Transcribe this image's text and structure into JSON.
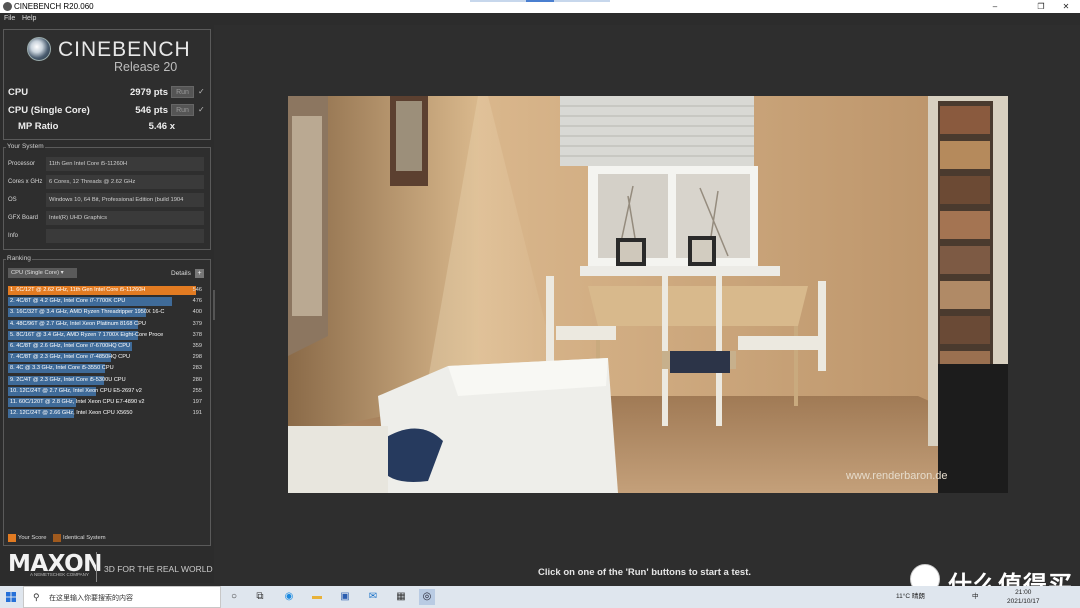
{
  "window": {
    "title": "CINEBENCH R20.060",
    "minimize": "–",
    "maximize": "❐",
    "close": "✕"
  },
  "menu": {
    "file": "File",
    "help": "Help"
  },
  "brand": {
    "name": "CINEBENCH",
    "release": "Release 20"
  },
  "scores": {
    "cpu_label": "CPU",
    "cpu_value": "2979 pts",
    "single_label": "CPU (Single Core)",
    "single_value": "546 pts",
    "mp_label": "MP Ratio",
    "mp_value": "5.46 x",
    "run_label": "Run",
    "check": "✓"
  },
  "system": {
    "group": "Your System",
    "rows": [
      {
        "label": "Processor",
        "value": "11th Gen Intel Core i5-11260H"
      },
      {
        "label": "Cores x GHz",
        "value": "6 Cores, 12 Threads @ 2.62 GHz"
      },
      {
        "label": "OS",
        "value": "Windows 10, 64 Bit, Professional Edition (build 1904"
      },
      {
        "label": "GFX Board",
        "value": "Intel(R) UHD Graphics"
      },
      {
        "label": "Info",
        "value": ""
      }
    ]
  },
  "ranking": {
    "group": "Ranking",
    "dropdown": "CPU (Single Core)",
    "details": "Details",
    "details_btn": "+",
    "max": 546,
    "rows": [
      {
        "text": "1. 6C/12T @ 2.62 GHz, 11th Gen Intel Core i5-11260H",
        "score": 546,
        "mine": true
      },
      {
        "text": "2. 4C/8T @ 4.2 GHz, Intel Core i7-7700K CPU",
        "score": 476,
        "mine": false
      },
      {
        "text": "3. 16C/32T @ 3.4 GHz, AMD Ryzen Threadripper 1950X 16-C",
        "score": 400,
        "mine": false
      },
      {
        "text": "4. 48C/96T @ 2.7 GHz, Intel Xeon Platinum 8168 CPU",
        "score": 379,
        "mine": false
      },
      {
        "text": "5. 8C/16T @ 3.4 GHz, AMD Ryzen 7 1700X Eight-Core Proce",
        "score": 378,
        "mine": false
      },
      {
        "text": "6. 4C/8T @ 2.6 GHz, Intel Core i7-6700HQ CPU",
        "score": 359,
        "mine": false
      },
      {
        "text": "7. 4C/8T @ 2.3 GHz, Intel Core i7-4850HQ CPU",
        "score": 298,
        "mine": false
      },
      {
        "text": "8. 4C @ 3.3 GHz, Intel Core i5-3550 CPU",
        "score": 283,
        "mine": false
      },
      {
        "text": "9. 2C/4T @ 2.3 GHz, Intel Core i5-5300U CPU",
        "score": 280,
        "mine": false
      },
      {
        "text": "10. 12C/24T @ 2.7 GHz, Intel Xeon CPU E5-2697 v2",
        "score": 255,
        "mine": false
      },
      {
        "text": "11. 60C/120T @ 2.8 GHz, Intel Xeon CPU E7-4890 v2",
        "score": 197,
        "mine": false
      },
      {
        "text": "12. 12C/24T @ 2.66 GHz, Intel Xeon CPU X5650",
        "score": 191,
        "mine": false
      }
    ],
    "legend_your": "Your Score",
    "legend_identical": "Identical System",
    "colors": {
      "mine": "#e27b22",
      "other": "#3f6b99",
      "identical": "#a05a1e"
    }
  },
  "footer": {
    "maxon": "MAXON",
    "maxon_sub": "A NEMETSCHEK COMPANY",
    "tagline": "3D FOR THE REAL WORLD"
  },
  "render": {
    "watermark": "www.renderbaron.de"
  },
  "status": "Click on one of the 'Run' buttons to start a test.",
  "taskbar": {
    "search_placeholder": "在这里输入你要搜索的内容",
    "weather": "11°C 晴朗",
    "ime": "中",
    "time": "21:00",
    "date": "2021/10/17",
    "icons": [
      "windows-icon",
      "task-view-icon",
      "widgets-icon",
      "edge-icon",
      "explorer-icon",
      "store-icon",
      "mail-icon",
      "calculator-icon",
      "cinebench-icon"
    ]
  },
  "overlay": {
    "text": "什么值得买"
  }
}
